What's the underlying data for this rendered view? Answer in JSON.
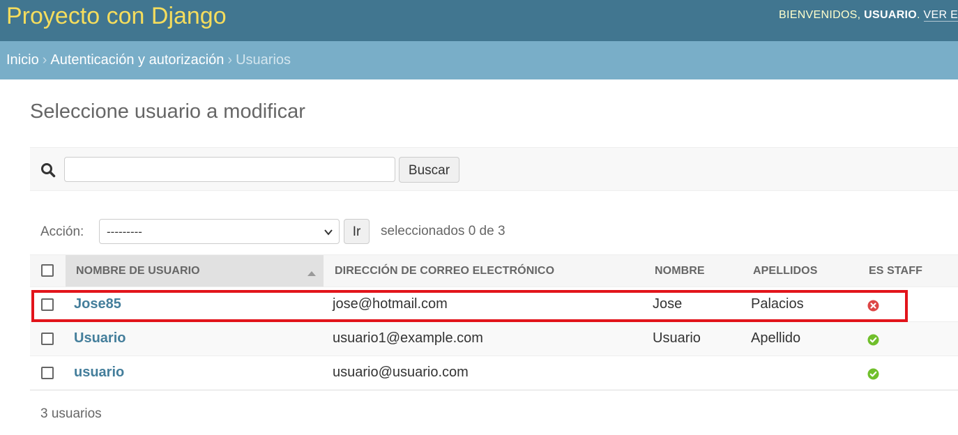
{
  "header": {
    "brand": "Proyecto con Django",
    "welcome": "BIENVENIDOS,",
    "username": "USUARIO",
    "dot": ".",
    "view_site": "VER EL"
  },
  "breadcrumbs": {
    "home": "Inicio",
    "separator": "›",
    "app": "Autenticación y autorización",
    "current": "Usuarios"
  },
  "page_title": "Seleccione usuario a modificar",
  "search": {
    "value": "",
    "placeholder": "",
    "button_label": "Buscar"
  },
  "actions": {
    "label": "Acción:",
    "selected_option": "---------",
    "go_label": "Ir",
    "selection_status": "seleccionados 0 de 3"
  },
  "table": {
    "columns": [
      "NOMBRE DE USUARIO",
      "DIRECCIÓN DE CORREO ELECTRÓNICO",
      "NOMBRE",
      "APELLIDOS",
      "ES STAFF"
    ],
    "sorted_column": "NOMBRE DE USUARIO",
    "rows": [
      {
        "username": "Jose85",
        "email": "jose@hotmail.com",
        "first_name": "Jose",
        "last_name": "Palacios",
        "is_staff": false,
        "highlighted": true
      },
      {
        "username": "Usuario",
        "email": "usuario1@example.com",
        "first_name": "Usuario",
        "last_name": "Apellido",
        "is_staff": true,
        "highlighted": false
      },
      {
        "username": "usuario",
        "email": "usuario@usuario.com",
        "first_name": "",
        "last_name": "",
        "is_staff": true,
        "highlighted": false
      }
    ]
  },
  "paginator": "3 usuarios",
  "colors": {
    "header_bg": "#417690",
    "brand": "#f5dd5d",
    "breadcrumb_bg": "#79aec8",
    "link": "#447e9b",
    "highlight": "#e2141b",
    "staff_yes": "#70bf2b",
    "staff_no": "#dd4646"
  },
  "icons": {
    "search": "search-icon",
    "select": "chevron-down-icon",
    "staff_yes": "check-circle-icon",
    "staff_no": "x-circle-icon"
  }
}
